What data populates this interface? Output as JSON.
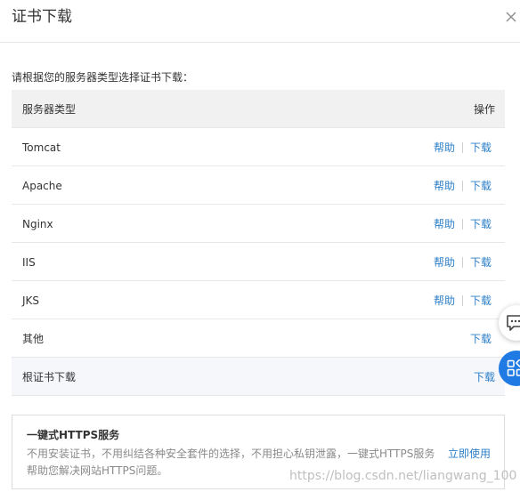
{
  "dialog": {
    "title": "证书下载",
    "close_icon": "close-icon"
  },
  "instruction": "请根据您的服务器类型选择证书下载：",
  "table": {
    "headers": {
      "type": "服务器类型",
      "operation": "操作"
    },
    "rows": [
      {
        "name": "Tomcat",
        "help": "帮助",
        "download": "下载"
      },
      {
        "name": "Apache",
        "help": "帮助",
        "download": "下载"
      },
      {
        "name": "Nginx",
        "help": "帮助",
        "download": "下载"
      },
      {
        "name": "IIS",
        "help": "帮助",
        "download": "下载"
      },
      {
        "name": "JKS",
        "help": "帮助",
        "download": "下载"
      },
      {
        "name": "其他",
        "download": "下载"
      }
    ],
    "root_row": {
      "name": "根证书下载",
      "download": "下载"
    }
  },
  "promo": {
    "title": "一键式HTTPS服务",
    "description": "不用安装证书，不用纠结各种安全套件的选择，不用担心私钥泄露，一键式HTTPS服务帮助您解决网站HTTPS问题。",
    "link": "立即使用"
  },
  "watermark": "https://blog.csdn.net/liangwang_100",
  "floating": {
    "chat_icon": "chat-icon",
    "apps_icon": "apps-grid-icon"
  },
  "colors": {
    "link": "#2d7fc8",
    "header_bg": "#f1f1f1",
    "floating_accent": "#1f7be3"
  }
}
